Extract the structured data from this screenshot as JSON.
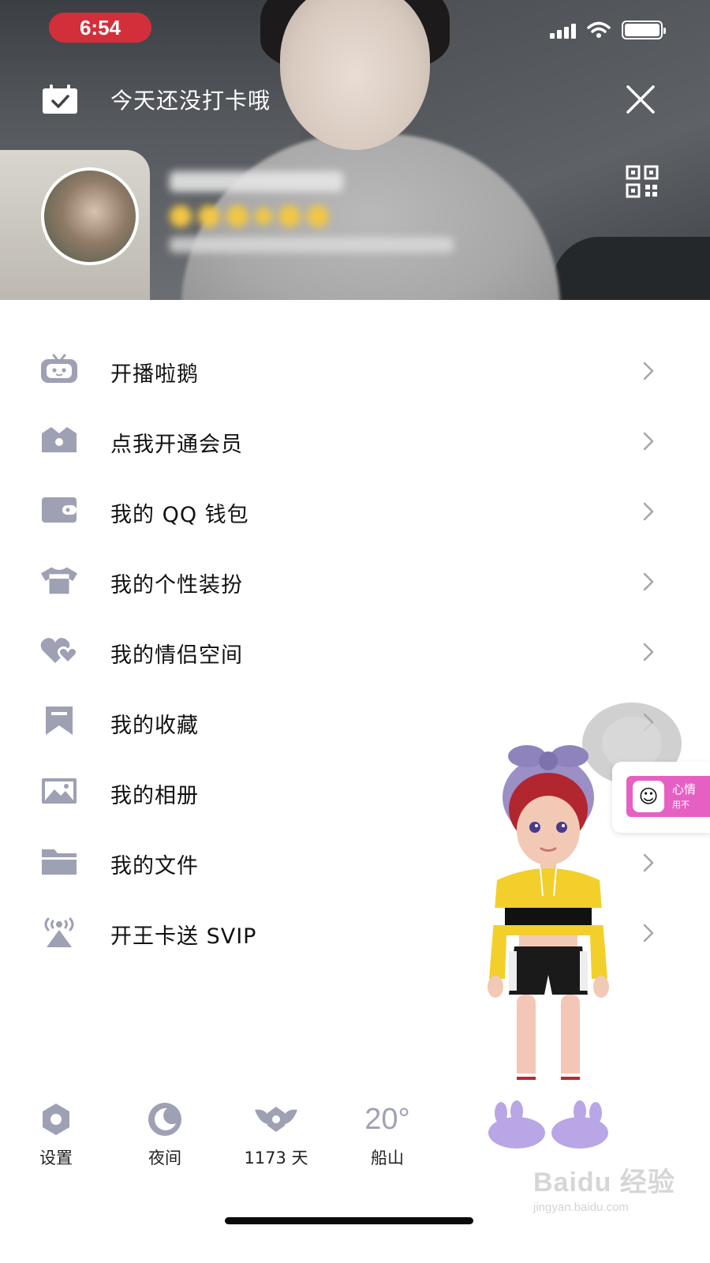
{
  "status_bar": {
    "time": "6:54"
  },
  "header": {
    "checkin_text": "今天还没打卡哦"
  },
  "menu": {
    "items": [
      {
        "label": "开播啦鹅",
        "icon": "tv-penguin-icon"
      },
      {
        "label": "点我开通会员",
        "icon": "crown-icon"
      },
      {
        "label": "我的 QQ 钱包",
        "icon": "wallet-icon"
      },
      {
        "label": "我的个性装扮",
        "icon": "shirt-icon"
      },
      {
        "label": "我的情侣空间",
        "icon": "hearts-icon"
      },
      {
        "label": "我的收藏",
        "icon": "bookmark-icon"
      },
      {
        "label": "我的相册",
        "icon": "picture-icon"
      },
      {
        "label": "我的文件",
        "icon": "folder-icon"
      },
      {
        "label": "开王卡送 SVIP",
        "icon": "broadcast-icon"
      }
    ]
  },
  "bottom_bar": {
    "settings_label": "设置",
    "night_label": "夜间",
    "days_label": "1173 天",
    "weather_temp": "20°",
    "weather_city": "船山"
  },
  "side_card": {
    "title": "心情",
    "subtitle": "用不"
  },
  "watermark": {
    "main": "Baidu 经验",
    "sub": "jingyan.baidu.com"
  },
  "colors": {
    "icon_gray": "#9ea0b4",
    "status_red": "#d32f3a",
    "watermark": "#c9c9c9"
  }
}
